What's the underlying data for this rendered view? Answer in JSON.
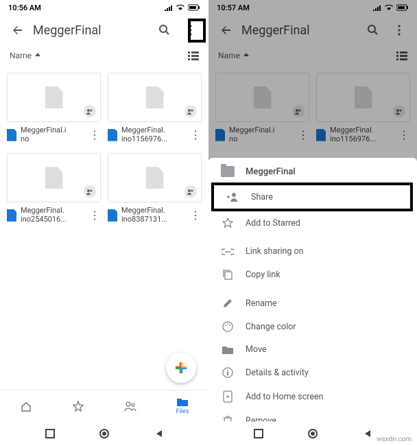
{
  "left": {
    "status_time": "10:56 AM",
    "title": "MeggerFinal",
    "sort_label": "Name",
    "files": [
      {
        "line1": "MeggerFinal.i",
        "line2": "no"
      },
      {
        "line1": "MeggerFinal.",
        "line2": "ino1156976..."
      },
      {
        "line1": "MeggerFinal.",
        "line2": "ino2545016..."
      },
      {
        "line1": "MeggerFinal.",
        "line2": "ino8387131..."
      }
    ],
    "nav_files": "Files"
  },
  "right": {
    "status_time": "10:57 AM",
    "title": "MeggerFinal",
    "sort_label": "Name",
    "files": [
      {
        "line1": "MeggerFinal.i",
        "line2": "no"
      },
      {
        "line1": "MeggerFinal.",
        "line2": "ino1156976..."
      }
    ],
    "sheet": {
      "folder_name": "MeggerFinal",
      "items": {
        "share": "Share",
        "star": "Add to Starred",
        "linksharing": "Link sharing on",
        "copylink": "Copy link",
        "rename": "Rename",
        "color": "Change color",
        "move": "Move",
        "details": "Details & activity",
        "homescreen": "Add to Home screen",
        "remove": "Remove"
      }
    }
  },
  "watermark": "wsxdn.com"
}
